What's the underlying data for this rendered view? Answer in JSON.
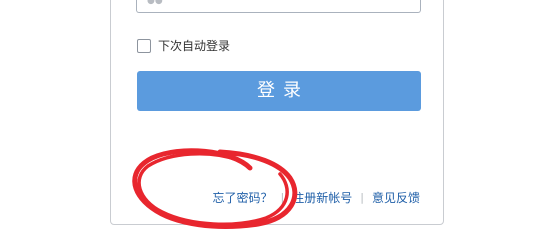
{
  "login_form": {
    "password_placeholder_fragment": "●●",
    "remember_me_label": "下次自动登录",
    "login_button_label": "登录"
  },
  "footer_links": {
    "forgot_password": "忘了密码？",
    "register": "注册新帐号",
    "feedback": "意见反馈"
  },
  "annotation": {
    "color": "#e8262e",
    "shape": "hand-drawn circle"
  },
  "colors": {
    "button_bg": "#5b9bde",
    "link": "#1f5fa8",
    "border": "#c9ccd1"
  }
}
